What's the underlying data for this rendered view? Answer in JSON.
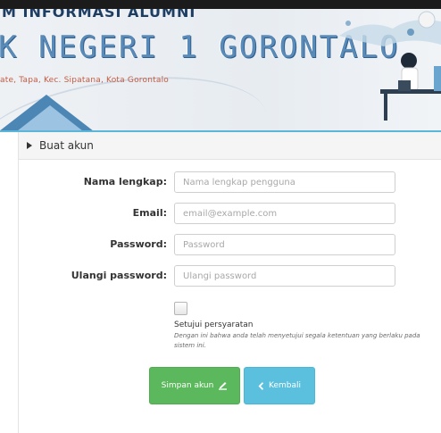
{
  "banner": {
    "title_top": "M INFORMASI ALUMNI",
    "title": "K NEGERI 1 GORONTALO",
    "address": "ate, Tapa, Kec. Sipatana, Kota Gorontalo"
  },
  "card": {
    "header": "Buat akun"
  },
  "form": {
    "fields": [
      {
        "label": "Nama lengkap:",
        "placeholder": "Nama lengkap pengguna"
      },
      {
        "label": "Email:",
        "placeholder": "email@example.com"
      },
      {
        "label": "Password:",
        "placeholder": "Password"
      },
      {
        "label": "Ulangi password:",
        "placeholder": "Ulangi password"
      }
    ],
    "agree_title": "Setujui persyaratan",
    "agree_desc": "Dengan ini bahwa anda telah menyetujui segala ketentuan yang berlaku pada sistem ini.",
    "save_label": "Simpan akun",
    "back_label": "Kembali"
  },
  "colors": {
    "save": "#5cb85c",
    "back": "#5bc0de",
    "accent": "#5bb6d9"
  },
  "icons": {
    "header_caret": "caret-right-icon",
    "save": "edit-icon",
    "back": "chevron-left-icon"
  }
}
